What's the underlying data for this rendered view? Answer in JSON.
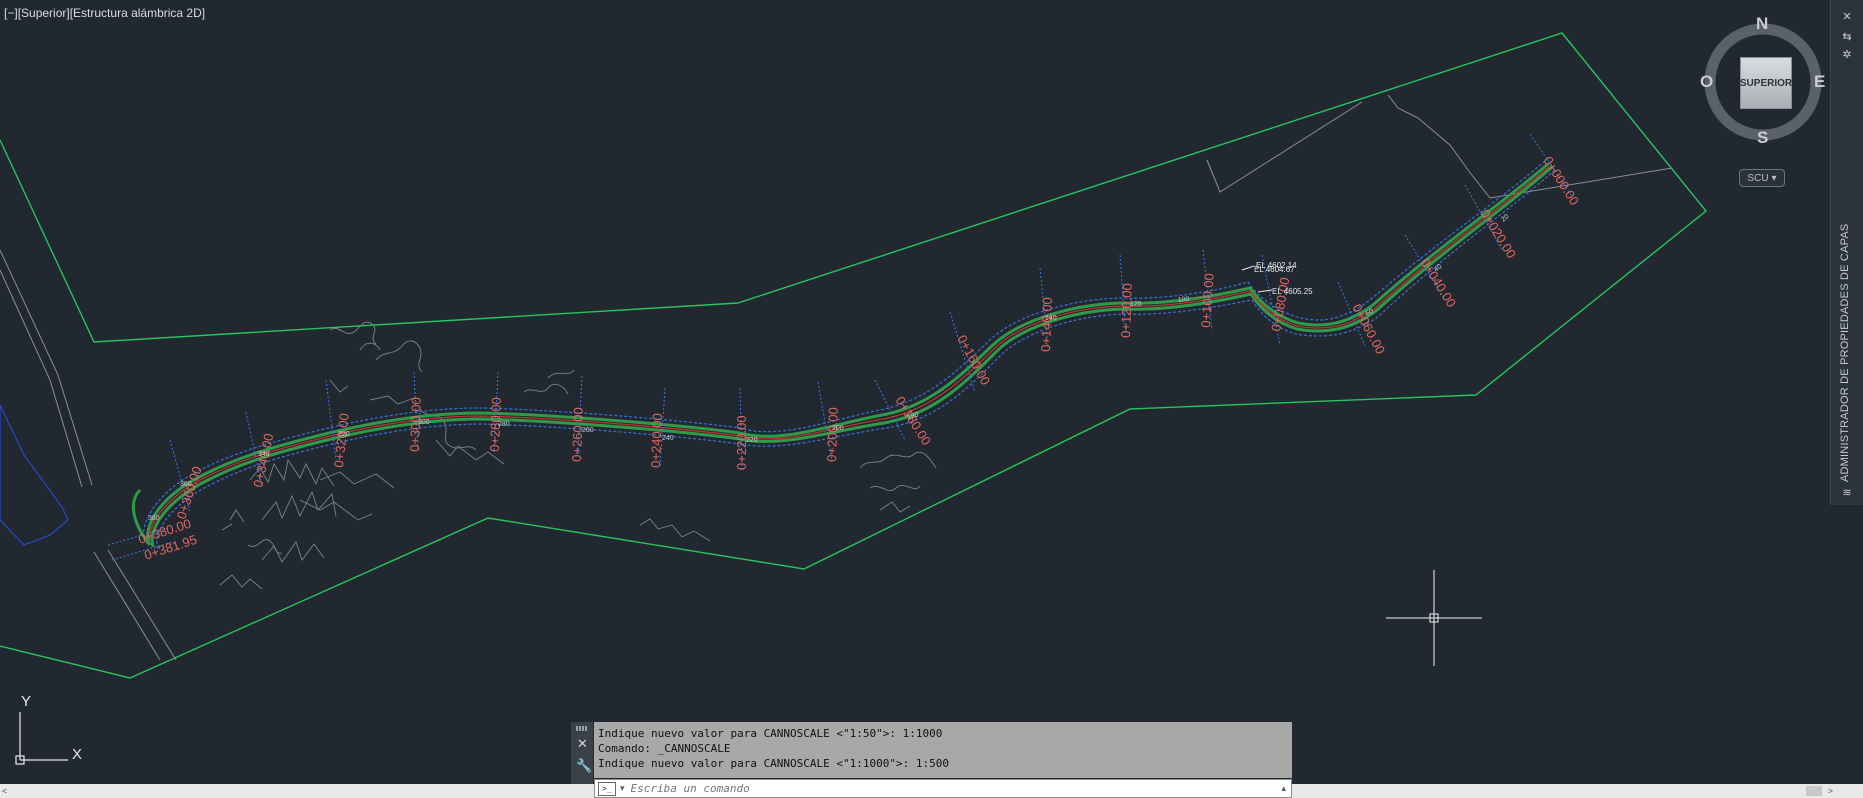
{
  "viewport": {
    "controls_label": "[−]",
    "view_label": "[Superior]",
    "style_label": "[Estructura alámbrica 2D]"
  },
  "viewcube": {
    "face_label": "SUPERIOR",
    "north": "N",
    "south": "S",
    "east": "E",
    "west": "O",
    "ucs_label": "SCU"
  },
  "ucs_icon": {
    "x_label": "X",
    "y_label": "Y"
  },
  "layer_palette": {
    "title": "ADMINISTRADOR DE PROPIEDADES DE CAPAS"
  },
  "stations": [
    "0+000.00",
    "0+020.00",
    "0+040.00",
    "0+060.00",
    "0+080.00",
    "0+100.00",
    "0+120.00",
    "0+140.00",
    "0+160.00",
    "0+180.00",
    "0+200.00",
    "0+220.00",
    "0+240.00",
    "0+260.00",
    "0+280.00",
    "0+300.00",
    "0+320.00",
    "0+340.00",
    "0+360.00",
    "0+380.00",
    "0+381.95"
  ],
  "minor_labels": [
    "20",
    "40",
    "60",
    "100",
    "120",
    "140",
    "180",
    "200",
    "220",
    "240",
    "260",
    "280",
    "300",
    "320",
    "340",
    "360",
    "380"
  ],
  "elevations": [
    "EL 4602.14",
    "EL 4604.67",
    "EL 4605.25"
  ],
  "command_line": {
    "history": [
      "Indique nuevo valor para CANNOSCALE <\"1:50\">: 1:1000",
      "Comando: _CANNOSCALE",
      "Indique nuevo valor para CANNOSCALE <\"1:1000\">: 1:500"
    ],
    "placeholder": "Escriba un comando"
  },
  "colors": {
    "background": "#212830",
    "boundary": "#27c45f",
    "road_edge": "#2f9a4a",
    "offset_line": "#3a6fd8",
    "centerline": "#c3322d",
    "station_text": "#e0685f",
    "contour": "#8a8f94"
  }
}
